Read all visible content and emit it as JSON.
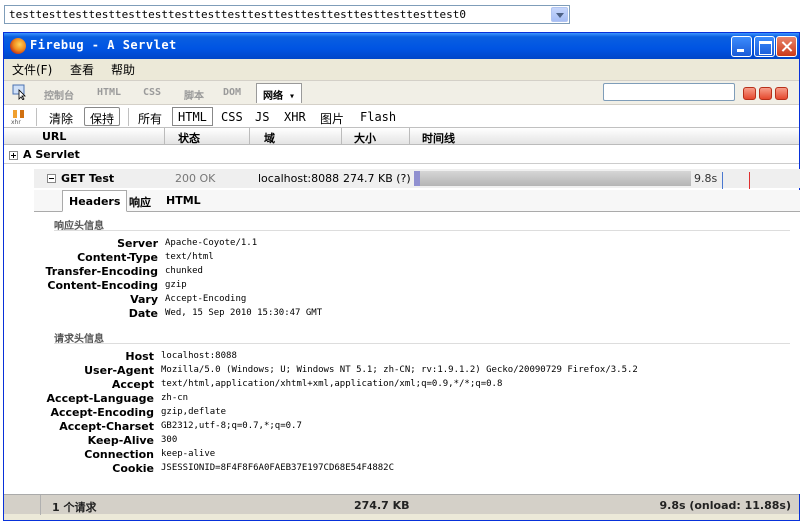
{
  "top_select": {
    "value": "testtesttesttesttesttesttesttesttesttesttesttesttesttesttesttesttest0"
  },
  "window": {
    "title": "Firebug - A Servlet"
  },
  "menu": {
    "items": [
      "文件(F)",
      "查看",
      "帮助"
    ]
  },
  "main_tabs": [
    "控制台",
    "HTML",
    "CSS",
    "脚本",
    "DOM",
    "网络 ▾"
  ],
  "filters": {
    "clear": "清除",
    "persist": "保持",
    "items": [
      "所有",
      "HTML",
      "CSS",
      "JS",
      "XHR",
      "图片",
      "Flash"
    ]
  },
  "columns": [
    "URL",
    "状态",
    "域",
    "大小",
    "时间线"
  ],
  "group": {
    "label": "A Servlet"
  },
  "request": {
    "method_url": "GET Test",
    "status": "200 OK",
    "domain": "localhost:8088",
    "size": "274.7 KB (?)",
    "time": "9.8s"
  },
  "detail_tabs": [
    "Headers",
    "响应",
    "HTML"
  ],
  "response_section": "响应头信息",
  "response_headers": [
    {
      "k": "Server",
      "v": "Apache-Coyote/1.1"
    },
    {
      "k": "Content-Type",
      "v": "text/html"
    },
    {
      "k": "Transfer-Encoding",
      "v": "chunked"
    },
    {
      "k": "Content-Encoding",
      "v": "gzip"
    },
    {
      "k": "Vary",
      "v": "Accept-Encoding"
    },
    {
      "k": "Date",
      "v": "Wed, 15 Sep 2010 15:30:47 GMT"
    }
  ],
  "request_section": "请求头信息",
  "request_headers": [
    {
      "k": "Host",
      "v": "localhost:8088"
    },
    {
      "k": "User-Agent",
      "v": "Mozilla/5.0 (Windows; U; Windows NT 5.1; zh-CN; rv:1.9.1.2) Gecko/20090729 Firefox/3.5.2"
    },
    {
      "k": "Accept",
      "v": "text/html,application/xhtml+xml,application/xml;q=0.9,*/*;q=0.8"
    },
    {
      "k": "Accept-Language",
      "v": "zh-cn"
    },
    {
      "k": "Accept-Encoding",
      "v": "gzip,deflate"
    },
    {
      "k": "Accept-Charset",
      "v": "GB2312,utf-8;q=0.7,*;q=0.7"
    },
    {
      "k": "Keep-Alive",
      "v": "300"
    },
    {
      "k": "Connection",
      "v": "keep-alive"
    },
    {
      "k": "Cookie",
      "v": "JSESSIONID=8F4F8F6A0FAEB37E197CD68E54F4882C"
    }
  ],
  "status": {
    "count": "1 个请求",
    "size": "274.7 KB",
    "time": "9.8s (onload: 11.88s)"
  },
  "timeline": {
    "fill_percent": 100,
    "start_color": "#9090d0",
    "mark_blue": "#4a78d0",
    "mark_red": "#e03030"
  }
}
